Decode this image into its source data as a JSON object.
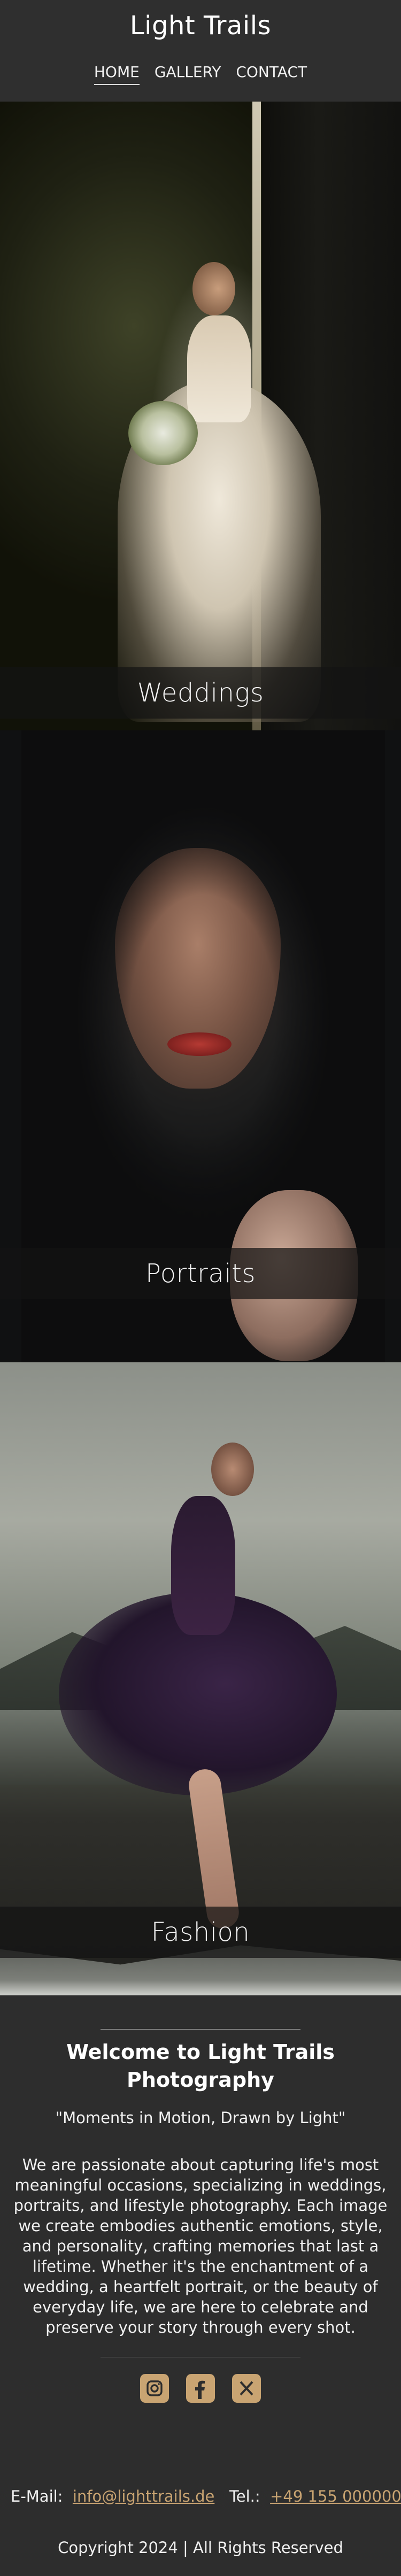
{
  "header": {
    "site_title": "Light Trails",
    "nav": [
      {
        "label": "HOME",
        "active": true
      },
      {
        "label": "GALLERY",
        "active": false
      },
      {
        "label": "CONTACT",
        "active": false
      }
    ]
  },
  "gallery": {
    "panels": [
      {
        "caption": "Weddings"
      },
      {
        "caption": "Portraits"
      },
      {
        "caption": "Fashion"
      }
    ]
  },
  "welcome": {
    "title": "Welcome to Light Trails Photography",
    "tagline": "\"Moments in Motion, Drawn by Light\"",
    "about": "We are passionate about capturing life's most meaningful occasions, specializing in weddings, portraits, and lifestyle photography. Each image we create embodies authentic emotions, style, and personality, crafting memories that last a lifetime. Whether it's the enchantment of a wedding, a heartfelt portrait, or the beauty of everyday life, we are here to celebrate and preserve your story through every shot."
  },
  "social": {
    "icons": [
      "instagram-icon",
      "facebook-icon",
      "x-icon"
    ],
    "accent_color": "#c9a472"
  },
  "footer": {
    "email_label": "E-Mail:",
    "email": "info@lighttrails.de",
    "phone_label": "Tel.:",
    "phone": "+49 155 000000",
    "copyright": "Copyright 2024 | All Rights Reserved"
  }
}
